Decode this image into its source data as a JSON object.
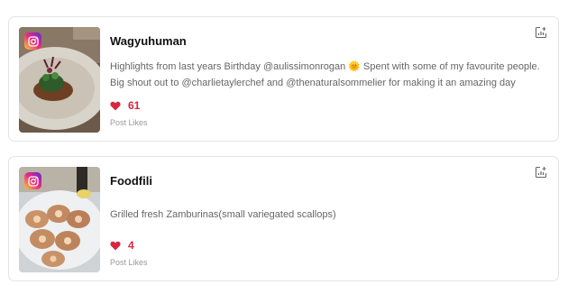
{
  "posts": [
    {
      "username": "Wagyuhuman",
      "caption": "Highlights from last years Birthday @aulissimonrogan 🌞 Spent with some of my favourite people. Big shout out to @charlietaylerchef and @thenaturalsommelier for making it an amazing day",
      "likes": "61",
      "likes_label": "Post Likes",
      "platform_icon": "instagram-icon",
      "stats_icon": "analytics-icon"
    },
    {
      "username": "Foodfili",
      "caption": "Grilled fresh Zamburinas(small variegated scallops)",
      "likes": "4",
      "likes_label": "Post Likes",
      "platform_icon": "instagram-icon",
      "stats_icon": "analytics-icon"
    }
  ],
  "colors": {
    "likes": "#d7263d",
    "border": "#e3e3e8",
    "caption": "#666666"
  }
}
